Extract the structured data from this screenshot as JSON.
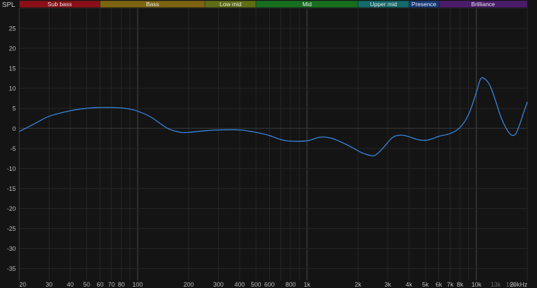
{
  "chart_data": {
    "type": "line",
    "ylabel": "SPL",
    "xscale": "log",
    "xlim": [
      20,
      20000
    ],
    "ylim": [
      -38,
      30
    ],
    "grid": true,
    "bands": [
      {
        "label": "Sub bass",
        "from": 20,
        "to": 60,
        "color": "#8b0f18"
      },
      {
        "label": "Bass",
        "from": 60,
        "to": 250,
        "color": "#7d6411"
      },
      {
        "label": "Low mid",
        "from": 250,
        "to": 500,
        "color": "#5f6e14"
      },
      {
        "label": "Mid",
        "from": 500,
        "to": 2000,
        "color": "#16701f"
      },
      {
        "label": "Upper mid",
        "from": 2000,
        "to": 4000,
        "color": "#136a6a"
      },
      {
        "label": "Presence",
        "from": 4000,
        "to": 6000,
        "color": "#173a7a"
      },
      {
        "label": "Brilliance",
        "from": 6000,
        "to": 20000,
        "color": "#4a1b6b"
      }
    ],
    "y_ticks": [
      25,
      20,
      15,
      10,
      5,
      0,
      -5,
      -10,
      -15,
      -20,
      -25,
      -30,
      -35
    ],
    "x_ticks": [
      {
        "v": 20,
        "label": "20"
      },
      {
        "v": 30,
        "label": "30"
      },
      {
        "v": 40,
        "label": "40"
      },
      {
        "v": 50,
        "label": "50"
      },
      {
        "v": 60,
        "label": "60"
      },
      {
        "v": 70,
        "label": "70"
      },
      {
        "v": 80,
        "label": "80"
      },
      {
        "v": 100,
        "label": "100"
      },
      {
        "v": 200,
        "label": "200"
      },
      {
        "v": 300,
        "label": "300"
      },
      {
        "v": 400,
        "label": "400"
      },
      {
        "v": 500,
        "label": "500"
      },
      {
        "v": 600,
        "label": "600"
      },
      {
        "v": 800,
        "label": "800"
      },
      {
        "v": 1000,
        "label": "1k"
      },
      {
        "v": 2000,
        "label": "2k"
      },
      {
        "v": 3000,
        "label": "3k"
      },
      {
        "v": 4000,
        "label": "4k"
      },
      {
        "v": 5000,
        "label": "5k"
      },
      {
        "v": 6000,
        "label": "6k"
      },
      {
        "v": 7000,
        "label": "7k"
      },
      {
        "v": 8000,
        "label": "8k"
      },
      {
        "v": 10000,
        "label": "10k"
      },
      {
        "v": 13000,
        "label": "13k",
        "dim": true
      },
      {
        "v": 16000,
        "label": "16k",
        "dim": true
      },
      {
        "v": 20000,
        "label": "20kHz"
      }
    ],
    "series": [
      {
        "color": "#3a86e0",
        "x": [
          20,
          25,
          30,
          40,
          50,
          60,
          70,
          80,
          90,
          100,
          120,
          150,
          180,
          200,
          250,
          300,
          400,
          500,
          600,
          700,
          800,
          1000,
          1200,
          1400,
          1700,
          2000,
          2200,
          2500,
          2800,
          3200,
          3600,
          4000,
          4500,
          5000,
          5500,
          6000,
          7000,
          8000,
          9000,
          10000,
          10500,
          11000,
          12000,
          13000,
          14000,
          15000,
          16000,
          17000,
          18000,
          19000,
          20000
        ],
        "y": [
          -0.8,
          1.3,
          3.0,
          4.4,
          5.0,
          5.2,
          5.2,
          5.1,
          4.8,
          4.3,
          2.8,
          0.0,
          -1.0,
          -1.0,
          -0.6,
          -0.4,
          -0.4,
          -1.0,
          -1.8,
          -2.8,
          -3.2,
          -3.1,
          -2.2,
          -2.5,
          -4.0,
          -5.6,
          -6.4,
          -6.8,
          -5.0,
          -2.3,
          -1.7,
          -2.1,
          -2.8,
          -3.0,
          -2.6,
          -2.0,
          -1.3,
          0.2,
          3.5,
          9.0,
          12.0,
          12.6,
          10.8,
          6.8,
          2.7,
          0.0,
          -1.6,
          -1.5,
          0.9,
          3.9,
          6.6
        ]
      }
    ]
  }
}
